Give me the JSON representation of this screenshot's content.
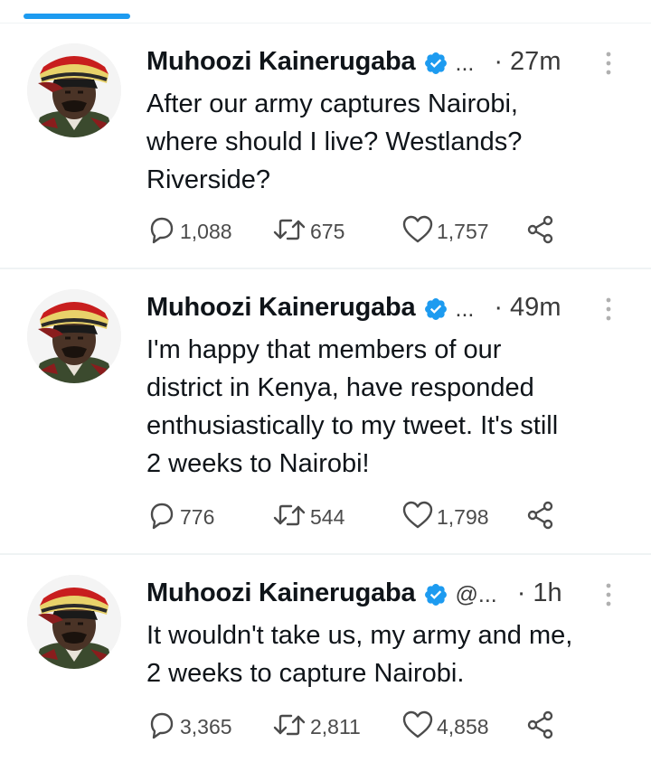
{
  "tweets": [
    {
      "display_name": "Muhoozi Kainerugaba",
      "handle": "...",
      "time": "· 27m",
      "text": "After our army captures Nairobi,\nwhere should I live? Westlands?\nRiverside?",
      "replies": "1,088",
      "retweets": "675",
      "likes": "1,757"
    },
    {
      "display_name": "Muhoozi Kainerugaba",
      "handle": "...",
      "time": "· 49m",
      "text": "I'm happy that members of our\ndistrict in Kenya, have responded\nenthusiastically to my tweet. It's still\n2 weeks to Nairobi!",
      "replies": "776",
      "retweets": "544",
      "likes": "1,798"
    },
    {
      "display_name": "Muhoozi Kainerugaba",
      "handle": "@...",
      "time": "· 1h",
      "text": "It wouldn't take us, my army and me,\n2 weeks to capture Nairobi.",
      "replies": "3,365",
      "retweets": "2,811",
      "likes": "4,858"
    }
  ],
  "icons": {
    "verified": "verified-badge-icon",
    "more": "more-vertical-icon",
    "reply": "reply-bubble-icon",
    "retweet": "retweet-icon",
    "like": "heart-icon",
    "share": "share-icon"
  },
  "colors": {
    "accent": "#1d9bf0",
    "text": "#0f1419",
    "muted": "#4b4b4b",
    "divider": "#eff3f4"
  }
}
